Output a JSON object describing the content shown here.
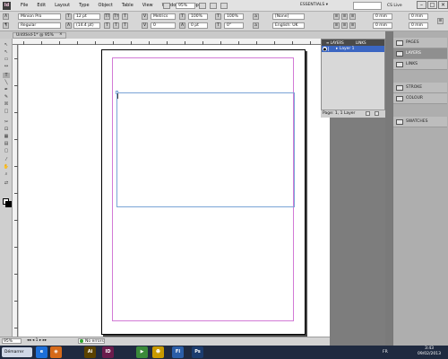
{
  "app": {
    "logo": "Id",
    "menus": [
      "File",
      "Edit",
      "Layout",
      "Type",
      "Object",
      "Table",
      "View",
      "Window",
      "Help"
    ]
  },
  "toolbar": {
    "zoom": "95%",
    "workspace": "ESSENTIALS ▾",
    "search_placeholder": "",
    "cs_live": "CS Live"
  },
  "control": {
    "font": "Minion Pro",
    "style": "Regular",
    "size": "12 pt",
    "leading": "(14.4 pt)",
    "kerning": "Metrics",
    "tracking": "0",
    "scale_v": "100%",
    "scale_h": "100%",
    "baseline": "0 pt",
    "skew": "0°",
    "char_style": "[None]",
    "language": "English: UK",
    "indent_1": "0 mm",
    "indent_2": "0 mm"
  },
  "document": {
    "tab_title": "Untitled-1* @ 95%",
    "close": "×"
  },
  "layers_panel": {
    "tabs": [
      "≡ LAYERS",
      "LINKS"
    ],
    "layer_name": "▸ Layer 1",
    "footer": "Page: 1, 1 Layer"
  },
  "dock": {
    "items": [
      {
        "label": "PAGES"
      },
      {
        "label": "LAYERS"
      },
      {
        "label": "LINKS"
      },
      {
        "label": "STROKE"
      },
      {
        "label": "COLOUR"
      },
      {
        "label": "SWATCHES"
      }
    ]
  },
  "status": {
    "zoom": "95%",
    "page_nav": "◂◂ ◂ 1 ▸ ▸▸",
    "preflight": "No errors"
  },
  "taskbar": {
    "start": "Démarrer",
    "apps": [
      "e",
      "◉",
      "Ai",
      "ID",
      "▶",
      "☻",
      "Fl",
      "Ps"
    ],
    "lang": "FR",
    "time": "3:43",
    "date": "09/02/2013"
  },
  "colors": {
    "margin": "#d27ad6",
    "frame": "#7aa4d6",
    "selection": "#3b66c2",
    "taskbar": "#1f2a40"
  }
}
